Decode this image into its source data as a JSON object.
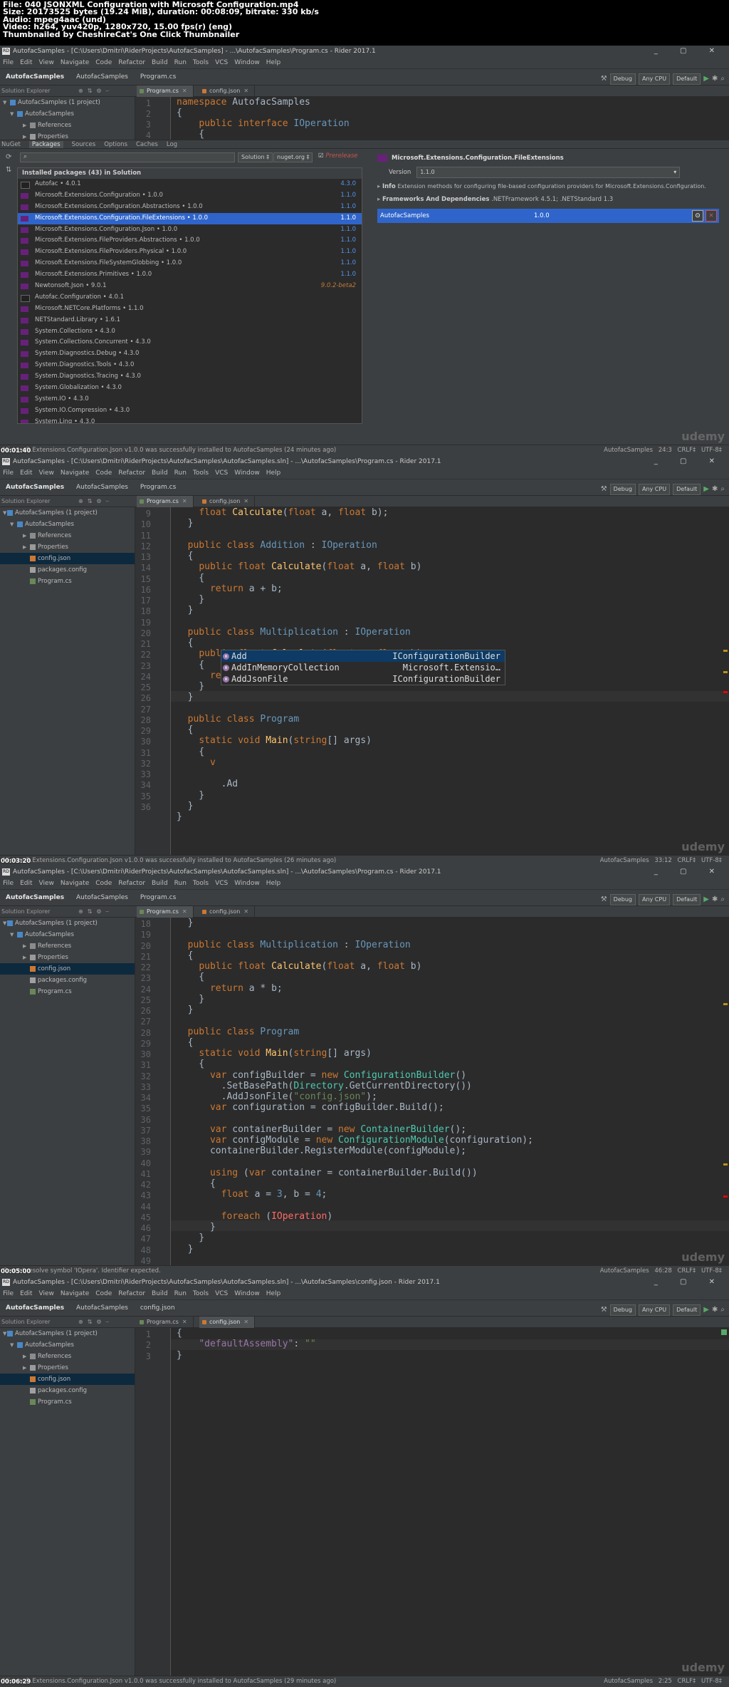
{
  "file_header": {
    "line1": "File: 040 JSONXML Configuration with Microsoft Configuration.mp4",
    "line2": "Size: 20173525 bytes (19.24 MiB), duration: 00:08:09, bitrate: 330 kb/s",
    "line3": "Audio: mpeg4aac (und)",
    "line4": "Video: h264, yuv420p, 1280x720, 15.00 fps(r) (eng)",
    "line5": "Thumbnailed by CheshireCat's One Click Thumbnailer"
  },
  "window_controls": "_ ▢ ✕",
  "menu": [
    "File",
    "Edit",
    "View",
    "Navigate",
    "Code",
    "Refactor",
    "Build",
    "Run",
    "Tools",
    "VCS",
    "Window",
    "Help"
  ],
  "toolbar": {
    "config": "Debug",
    "platform": "Any CPU",
    "target": "Default"
  },
  "sidebar_title": "Solution Explorer",
  "watermark": "udemy",
  "frames": [
    {
      "title": "AutofacSamples - [C:\\Users\\Dmitri\\RiderProjects\\AutofacSamples] - ...\\AutofacSamples\\Program.cs - Rider 2017.1",
      "crumbs": [
        "AutofacSamples",
        "AutofacSamples",
        "Program.cs"
      ],
      "tabs": [
        "Program.cs",
        "config.json"
      ],
      "timestamp": "00:01:40",
      "status": "Microsoft.Extensions.Configuration.Json v1.0.0 was successfully installed to AutofacSamples (24 minutes ago)",
      "status_right": "AutofacSamples  24:3  CRLF‡  UTF-8‡",
      "tree": [
        "AutofacSamples (1 project)",
        "AutofacSamples",
        "References",
        "Properties"
      ],
      "code_lines": [
        "1",
        "2",
        "3",
        "4"
      ],
      "nuget": {
        "tabs": [
          "NuGet",
          "Packages",
          "Sources",
          "Options",
          "Caches",
          "Log"
        ],
        "scope": "Solution ‡",
        "source": "nuget.org ‡",
        "prerelease": "Prerelease",
        "list_header": "Installed packages (43) in Solution",
        "packages": [
          {
            "name": "Autofac • 4.0.1",
            "ver": "4.3.0"
          },
          {
            "name": "Microsoft.Extensions.Configuration • 1.0.0",
            "ver": "1.1.0"
          },
          {
            "name": "Microsoft.Extensions.Configuration.Abstractions • 1.0.0",
            "ver": "1.1.0"
          },
          {
            "name": "Microsoft.Extensions.Configuration.FileExtensions • 1.0.0",
            "ver": "1.1.0"
          },
          {
            "name": "Microsoft.Extensions.Configuration.Json • 1.0.0",
            "ver": "1.1.0"
          },
          {
            "name": "Microsoft.Extensions.FileProviders.Abstractions • 1.0.0",
            "ver": "1.1.0"
          },
          {
            "name": "Microsoft.Extensions.FileProviders.Physical • 1.0.0",
            "ver": "1.1.0"
          },
          {
            "name": "Microsoft.Extensions.FileSystemGlobbing • 1.0.0",
            "ver": "1.1.0"
          },
          {
            "name": "Microsoft.Extensions.Primitives • 1.0.0",
            "ver": "1.1.0"
          },
          {
            "name": "Newtonsoft.Json • 9.0.1",
            "ver": "9.0.2-beta2"
          },
          {
            "name": "Autofac.Configuration • 4.0.1",
            "ver": ""
          },
          {
            "name": "Microsoft.NETCore.Platforms • 1.1.0",
            "ver": ""
          },
          {
            "name": "NETStandard.Library • 1.6.1",
            "ver": ""
          },
          {
            "name": "System.Collections • 4.3.0",
            "ver": ""
          },
          {
            "name": "System.Collections.Concurrent • 4.3.0",
            "ver": ""
          },
          {
            "name": "System.Diagnostics.Debug • 4.3.0",
            "ver": ""
          },
          {
            "name": "System.Diagnostics.Tools • 4.3.0",
            "ver": ""
          },
          {
            "name": "System.Diagnostics.Tracing • 4.3.0",
            "ver": ""
          },
          {
            "name": "System.Globalization • 4.3.0",
            "ver": ""
          },
          {
            "name": "System.IO • 4.3.0",
            "ver": ""
          },
          {
            "name": "System.IO.Compression • 4.3.0",
            "ver": ""
          },
          {
            "name": "System.Linq • 4.3.0",
            "ver": ""
          }
        ],
        "detail": {
          "name": "Microsoft.Extensions.Configuration.FileExtensions",
          "version_label": "Version",
          "version": "1.1.0",
          "info_label": "Info",
          "info": "Extension methods for configuring file-based configuration providers for Microsoft.Extensions.Configuration.",
          "frameworks_label": "Frameworks And Dependencies",
          "frameworks": ".NETFramework 4.5.1; .NETStandard 1.3",
          "project": "AutofacSamples",
          "project_ver": "1.0.0"
        }
      }
    },
    {
      "title": "AutofacSamples - [C:\\Users\\Dmitri\\RiderProjects\\AutofacSamples\\AutofacSamples.sln] - ...\\AutofacSamples\\Program.cs - Rider 2017.1",
      "crumbs": [
        "AutofacSamples",
        "AutofacSamples",
        "Program.cs"
      ],
      "tabs": [
        "Program.cs",
        "config.json"
      ],
      "timestamp": "00:03:20",
      "status": "Microsoft.Extensions.Configuration.Json v1.0.0 was successfully installed to AutofacSamples (26 minutes ago)",
      "status_right": "AutofacSamples  33:12  CRLF‡  UTF-8‡",
      "tree": [
        "AutofacSamples (1 project)",
        "AutofacSamples",
        "References",
        "Properties",
        "config.json",
        "packages.config",
        "Program.cs"
      ],
      "popup": [
        {
          "name": "Add",
          "type": "IConfigurationBuilder"
        },
        {
          "name": "AddInMemoryCollection",
          "type": "Microsoft.Extensio…"
        },
        {
          "name": "AddJsonFile",
          "type": "IConfigurationBuilder"
        }
      ]
    },
    {
      "title": "AutofacSamples - [C:\\Users\\Dmitri\\RiderProjects\\AutofacSamples\\AutofacSamples.sln] - ...\\AutofacSamples\\Program.cs - Rider 2017.1",
      "crumbs": [
        "AutofacSamples",
        "AutofacSamples",
        "Program.cs"
      ],
      "tabs": [
        "Program.cs",
        "config.json"
      ],
      "timestamp": "00:05:00",
      "status": "Cannot resolve symbol 'IOpera'. Identifier expected.",
      "status_right": "AutofacSamples  46:28  CRLF‡  UTF-8‡",
      "tree": [
        "AutofacSamples (1 project)",
        "AutofacSamples",
        "References",
        "Properties",
        "config.json",
        "packages.config",
        "Program.cs"
      ]
    },
    {
      "title": "AutofacSamples - [C:\\Users\\Dmitri\\RiderProjects\\AutofacSamples\\AutofacSamples.sln] - ...\\AutofacSamples\\config.json - Rider 2017.1",
      "crumbs": [
        "AutofacSamples",
        "AutofacSamples",
        "config.json"
      ],
      "tabs": [
        "Program.cs",
        "config.json"
      ],
      "timestamp": "00:06:29",
      "status": "Microsoft.Extensions.Configuration.Json v1.0.0 was successfully installed to AutofacSamples (29 minutes ago)",
      "status_right": "AutofacSamples  2:25  CRLF‡  UTF-8‡",
      "tree": [
        "AutofacSamples (1 project)",
        "AutofacSamples",
        "References",
        "Properties",
        "config.json",
        "packages.config",
        "Program.cs"
      ]
    }
  ]
}
